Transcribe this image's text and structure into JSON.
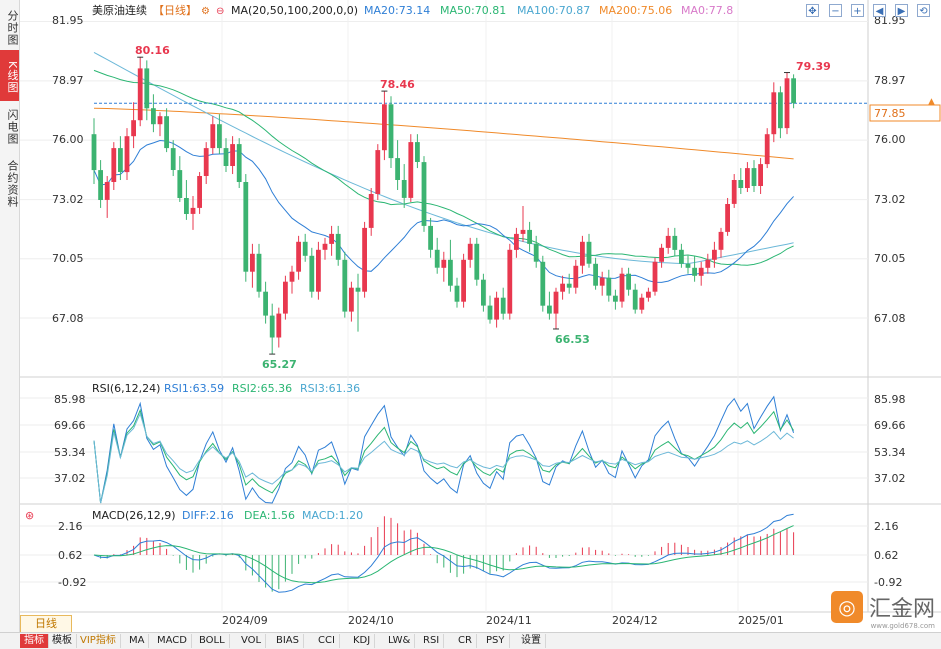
{
  "sidebar": {
    "tabs": [
      {
        "label": "分时图",
        "active": false
      },
      {
        "label": "K线图",
        "active": true
      },
      {
        "label": "闪电图",
        "active": false
      },
      {
        "label": "合约资料",
        "active": false
      }
    ]
  },
  "main_header": {
    "symbol": "美原油连续",
    "period": "【日线】",
    "ma_label": "MA(20,50,100,200,0,0)",
    "ma20": "MA20:73.14",
    "ma50": "MA50:70.81",
    "ma100": "MA100:70.87",
    "ma200": "MA200:75.06",
    "ma0": "MA0:77.8"
  },
  "rsi_header": {
    "label": "RSI(6,12,24)",
    "rsi1": "RSI1:63.59",
    "rsi2": "RSI2:65.36",
    "rsi3": "RSI3:61.36"
  },
  "macd_header": {
    "label": "MACD(26,12,9)",
    "diff": "DIFF:2.16",
    "dea": "DEA:1.56",
    "macd": "MACD:1.20"
  },
  "price_axis": {
    "ticks": [
      "81.95",
      "78.97",
      "76.00",
      "73.02",
      "70.05",
      "67.08"
    ],
    "current": "77.85"
  },
  "rsi_axis": {
    "ticks": [
      "85.98",
      "69.66",
      "53.34",
      "37.02"
    ]
  },
  "macd_axis": {
    "ticks": [
      "2.16",
      "0.62",
      "-0.92"
    ]
  },
  "x_axis": {
    "labels": [
      "2024/09",
      "2024/10",
      "2024/11",
      "2024/12",
      "2025/01"
    ]
  },
  "annotations": {
    "high1": "80.16",
    "high2": "78.46",
    "high3": "79.39",
    "low1": "65.27",
    "low2": "66.53"
  },
  "period_tab": "日线",
  "toolbar": [
    "指标",
    "模板",
    "VIP指标",
    "MA",
    "MACD",
    "BOLL",
    "VOL",
    "BIAS",
    "CCI",
    "KDJ",
    "LW&",
    "RSI",
    "CR",
    "PSY",
    "设置"
  ],
  "logo": {
    "text": "汇金网",
    "sub": "www.gold678.com"
  },
  "colors": {
    "up": "#e8384f",
    "down": "#3cb371",
    "ma20": "#2f7fd6",
    "ma50": "#2bb673",
    "ma100": "#6cb8d8",
    "ma200": "#f08a2a",
    "current_line": "#2f7fd6"
  },
  "chart_data": {
    "type": "candlestick",
    "y_range": [
      64.5,
      82.3
    ],
    "x_labels": [
      "2024/09",
      "2024/10",
      "2024/11",
      "2024/12",
      "2025/01"
    ],
    "candles": [
      [
        76.3,
        77.1,
        73.8,
        74.5
      ],
      [
        74.5,
        75.0,
        72.6,
        73.0
      ],
      [
        73.0,
        74.2,
        72.1,
        73.9
      ],
      [
        73.9,
        75.9,
        73.5,
        75.6
      ],
      [
        75.6,
        76.2,
        74.0,
        74.4
      ],
      [
        74.4,
        76.6,
        74.0,
        76.2
      ],
      [
        76.2,
        77.9,
        75.6,
        77.0
      ],
      [
        77.0,
        80.16,
        76.7,
        79.6
      ],
      [
        79.6,
        80.0,
        77.0,
        77.6
      ],
      [
        77.6,
        78.3,
        76.4,
        76.8
      ],
      [
        76.8,
        77.4,
        76.2,
        77.2
      ],
      [
        77.2,
        77.6,
        75.4,
        75.6
      ],
      [
        75.6,
        76.0,
        74.2,
        74.5
      ],
      [
        74.5,
        75.2,
        72.9,
        73.1
      ],
      [
        73.1,
        74.0,
        72.0,
        72.3
      ],
      [
        72.3,
        73.2,
        71.5,
        72.6
      ],
      [
        72.6,
        74.4,
        72.3,
        74.2
      ],
      [
        74.2,
        75.9,
        73.8,
        75.6
      ],
      [
        75.6,
        77.2,
        75.3,
        76.8
      ],
      [
        76.8,
        77.3,
        75.3,
        75.6
      ],
      [
        75.6,
        76.1,
        74.4,
        74.7
      ],
      [
        74.7,
        76.2,
        74.3,
        75.8
      ],
      [
        75.8,
        76.1,
        73.6,
        73.9
      ],
      [
        73.9,
        74.3,
        68.9,
        69.4
      ],
      [
        69.4,
        70.8,
        68.6,
        70.3
      ],
      [
        70.3,
        70.8,
        68.1,
        68.4
      ],
      [
        68.4,
        68.9,
        66.8,
        67.2
      ],
      [
        67.2,
        67.8,
        65.27,
        66.1
      ],
      [
        66.1,
        67.6,
        65.6,
        67.3
      ],
      [
        67.3,
        69.2,
        67.0,
        68.9
      ],
      [
        68.9,
        69.7,
        68.3,
        69.4
      ],
      [
        69.4,
        71.2,
        69.0,
        70.9
      ],
      [
        70.9,
        71.3,
        69.9,
        70.2
      ],
      [
        70.2,
        70.6,
        68.1,
        68.4
      ],
      [
        68.4,
        70.9,
        68.0,
        70.5
      ],
      [
        70.5,
        71.1,
        70.0,
        70.8
      ],
      [
        70.8,
        71.7,
        70.2,
        71.3
      ],
      [
        71.3,
        71.7,
        69.7,
        70.0
      ],
      [
        70.0,
        70.4,
        67.1,
        67.4
      ],
      [
        67.4,
        68.9,
        66.9,
        68.6
      ],
      [
        68.6,
        69.3,
        66.4,
        68.4
      ],
      [
        68.4,
        71.9,
        68.1,
        71.6
      ],
      [
        71.6,
        73.6,
        71.2,
        73.3
      ],
      [
        73.3,
        75.8,
        73.0,
        75.5
      ],
      [
        75.5,
        78.46,
        75.0,
        77.8
      ],
      [
        77.8,
        78.2,
        74.6,
        75.1
      ],
      [
        75.1,
        76.0,
        73.5,
        74.0
      ],
      [
        74.0,
        74.8,
        72.6,
        73.1
      ],
      [
        73.1,
        76.3,
        72.9,
        75.9
      ],
      [
        75.9,
        76.3,
        74.6,
        74.9
      ],
      [
        74.9,
        75.2,
        71.4,
        71.7
      ],
      [
        71.7,
        72.1,
        70.1,
        70.5
      ],
      [
        70.5,
        71.1,
        69.3,
        69.6
      ],
      [
        69.6,
        70.4,
        68.9,
        70.0
      ],
      [
        70.0,
        71.0,
        68.4,
        68.7
      ],
      [
        68.7,
        69.1,
        67.6,
        67.9
      ],
      [
        67.9,
        70.3,
        67.6,
        70.0
      ],
      [
        70.0,
        71.1,
        69.6,
        70.8
      ],
      [
        70.8,
        71.1,
        68.7,
        69.0
      ],
      [
        69.0,
        69.3,
        67.4,
        67.7
      ],
      [
        67.7,
        68.2,
        66.8,
        67.0
      ],
      [
        67.0,
        68.4,
        66.6,
        68.1
      ],
      [
        68.1,
        68.6,
        67.0,
        67.3
      ],
      [
        67.3,
        70.8,
        67.0,
        70.5
      ],
      [
        70.5,
        71.6,
        70.1,
        71.3
      ],
      [
        71.3,
        72.7,
        70.9,
        71.5
      ],
      [
        71.5,
        71.9,
        70.4,
        70.8
      ],
      [
        70.8,
        71.2,
        69.6,
        69.9
      ],
      [
        69.9,
        70.2,
        67.4,
        67.7
      ],
      [
        67.7,
        68.4,
        67.0,
        67.3
      ],
      [
        67.3,
        68.6,
        66.53,
        68.4
      ],
      [
        68.4,
        69.2,
        68.0,
        68.8
      ],
      [
        68.8,
        69.3,
        68.3,
        68.6
      ],
      [
        68.6,
        70.0,
        68.3,
        69.7
      ],
      [
        69.7,
        71.2,
        69.3,
        70.9
      ],
      [
        70.9,
        71.3,
        69.6,
        69.8
      ],
      [
        69.8,
        70.1,
        68.5,
        68.7
      ],
      [
        68.7,
        69.4,
        68.2,
        69.1
      ],
      [
        69.1,
        69.5,
        67.9,
        68.2
      ],
      [
        68.2,
        68.5,
        67.5,
        67.9
      ],
      [
        67.9,
        69.6,
        67.6,
        69.3
      ],
      [
        69.3,
        69.6,
        68.2,
        68.5
      ],
      [
        68.5,
        68.8,
        67.3,
        67.5
      ],
      [
        67.5,
        68.3,
        67.3,
        68.1
      ],
      [
        68.1,
        68.6,
        67.9,
        68.4
      ],
      [
        68.4,
        70.1,
        68.2,
        69.9
      ],
      [
        69.9,
        70.8,
        69.6,
        70.6
      ],
      [
        70.6,
        71.6,
        70.3,
        71.2
      ],
      [
        71.2,
        71.6,
        70.2,
        70.5
      ],
      [
        70.5,
        70.8,
        69.6,
        69.8
      ],
      [
        69.8,
        70.2,
        69.3,
        69.6
      ],
      [
        69.6,
        70.2,
        68.9,
        69.2
      ],
      [
        69.2,
        69.9,
        68.7,
        69.6
      ],
      [
        69.6,
        70.3,
        69.3,
        70.0
      ],
      [
        70.0,
        70.9,
        69.6,
        70.5
      ],
      [
        70.5,
        71.6,
        70.1,
        71.4
      ],
      [
        71.4,
        73.1,
        71.2,
        72.8
      ],
      [
        72.8,
        74.3,
        72.6,
        74.0
      ],
      [
        74.0,
        74.6,
        73.3,
        73.6
      ],
      [
        73.6,
        74.9,
        73.4,
        74.6
      ],
      [
        74.6,
        75.0,
        73.4,
        73.7
      ],
      [
        73.7,
        75.1,
        73.3,
        74.8
      ],
      [
        74.8,
        76.6,
        74.6,
        76.3
      ],
      [
        76.3,
        78.9,
        75.9,
        78.4
      ],
      [
        78.4,
        78.7,
        76.1,
        76.6
      ],
      [
        76.6,
        79.39,
        76.3,
        79.1
      ],
      [
        79.1,
        79.3,
        77.6,
        77.85
      ]
    ]
  }
}
